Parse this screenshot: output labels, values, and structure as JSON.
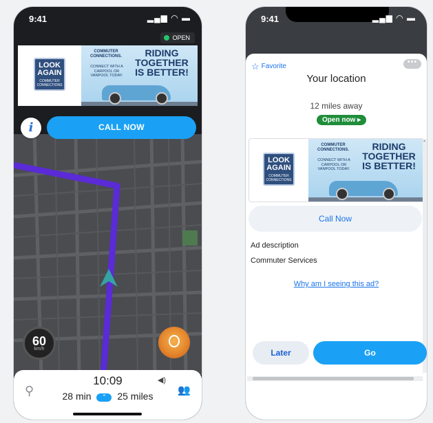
{
  "left_phone": {
    "status_time": "9:41",
    "status_icons": "▂▄▆ ◠ ▬",
    "open_chip": "OPEN",
    "ad": {
      "logo_line1": "LOOK",
      "logo_line2": "AGAIN",
      "logo_sub": "COMMUTER CONNECTIONS",
      "brand": "COMMUTER CONNECTIONS.",
      "brand_tagline": "CONNECT WITH A CARPOOL OR VANPOOL TODAY.",
      "headline": "RIDING TOGETHER IS BETTER!"
    },
    "info_glyph": "i",
    "call_now": "CALL NOW",
    "speed_value": "60",
    "speed_unit": "km/h",
    "eta_clock": "10:09",
    "eta_duration": "28 min",
    "route_glyph": "⌃",
    "eta_distance": "25 miles",
    "search_glyph": "⚲",
    "sound_glyph": "◀)",
    "people_glyph": "👥"
  },
  "right_phone": {
    "status_time": "9:41",
    "status_icons": "▂▄▆ ◠ ▬",
    "favorite_label": "Favorite",
    "favorite_glyph": "☆",
    "more_glyph": "•••",
    "location_title": "Your location",
    "distance": "12 miles away",
    "open_now": "Open now ▸",
    "ad": {
      "logo_line1": "LOOK",
      "logo_line2": "AGAIN",
      "logo_sub": "COMMUTER CONNECTIONS",
      "brand": "COMMUTER CONNECTIONS.",
      "brand_tagline": "CONNECT WITH A CARPOOL OR VANPOOL TODAY.",
      "headline": "RIDING TOGETHER IS BETTER!"
    },
    "call_now": "Call Now",
    "ad_description": "Ad description",
    "advertiser": "Commuter Services",
    "why_link": "Why am I seeing this ad?",
    "later": "Later",
    "go": "Go"
  },
  "colors": {
    "accent_blue": "#1aa1f5",
    "open_green": "#25c36b",
    "route_purple": "#5a2bd6",
    "link_blue": "#1a73e8"
  }
}
